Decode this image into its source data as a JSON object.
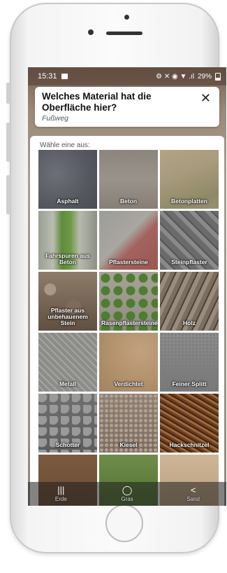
{
  "status_bar": {
    "time": "15:31",
    "right_icons": "⚙ ✕ ◉ ▼ .ıl",
    "battery": "29%"
  },
  "question": {
    "title": "Welches Material hat die Oberfläche hier?",
    "subtitle": "Fußweg",
    "close_glyph": "✕"
  },
  "answers": {
    "prompt": "Wähle eine aus:",
    "options": [
      {
        "label": "Asphalt"
      },
      {
        "label": "Beton"
      },
      {
        "label": "Betonplatten"
      },
      {
        "label": "Fahrspuren aus Beton"
      },
      {
        "label": "Pflastersteine"
      },
      {
        "label": "Steinpflaster"
      },
      {
        "label": "Pflaster aus unbehauenem Stein"
      },
      {
        "label": "Rasenpflastersteine"
      },
      {
        "label": "Holz"
      },
      {
        "label": "Metall"
      },
      {
        "label": "Verdichtet"
      },
      {
        "label": "Feiner Splitt"
      },
      {
        "label": "Schotter"
      },
      {
        "label": "Kiesel"
      },
      {
        "label": "Hackschnitzel"
      },
      {
        "label": "Erde"
      },
      {
        "label": "Gras"
      },
      {
        "label": "Sand"
      }
    ]
  },
  "nav": {
    "recent_glyph": "|||",
    "home_glyph": "◯",
    "back_glyph": "<"
  }
}
